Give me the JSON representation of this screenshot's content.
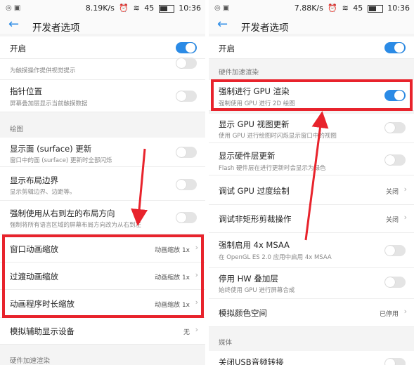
{
  "left": {
    "status": {
      "left_icons": "◎ ▣",
      "speed": "8.19K/s",
      "signal": "45",
      "time": "10:36"
    },
    "header": {
      "title": "开发者选项"
    },
    "rows": [
      {
        "label": "开启"
      },
      {
        "sub": "为触摸操作提供视觉提示"
      },
      {
        "label": "指针位置",
        "sub": "屏幕叠加层显示当前触摸数据"
      },
      {
        "section": "绘图"
      },
      {
        "label": "显示面 (surface) 更新",
        "sub": "窗口中的面 (surface) 更新时全部闪烁"
      },
      {
        "label": "显示布局边界",
        "sub": "显示剪辑边界、边距等。"
      },
      {
        "label": "强制使用从右到左的布局方向",
        "sub": "强制将所有语言区域的屏幕布局方向改为从右到左"
      },
      {
        "label": "窗口动画缩放",
        "value": "动画缩放 1x"
      },
      {
        "label": "过渡动画缩放",
        "value": "动画缩放 1x"
      },
      {
        "label": "动画程序时长缩放",
        "value": "动画缩放 1x"
      },
      {
        "label": "模拟辅助显示设备",
        "value": "无"
      },
      {
        "section": "硬件加速渲染"
      }
    ]
  },
  "right": {
    "status": {
      "left_icons": "◎ ▣",
      "speed": "7.88K/s",
      "signal": "45",
      "time": "10:36"
    },
    "header": {
      "title": "开发者选项"
    },
    "rows": [
      {
        "label": "开启"
      },
      {
        "section": "硬件加速渲染"
      },
      {
        "label": "强制进行 GPU 渲染",
        "sub": "强制使用 GPU 进行 2D 绘图"
      },
      {
        "label": "显示 GPU 视图更新",
        "sub": "使用 GPU 进行绘图时闪烁显示窗口中的视图"
      },
      {
        "label": "显示硬件层更新",
        "sub": "Flash 硬件层在进行更新时会显示为绿色"
      },
      {
        "label": "调试 GPU 过度绘制",
        "value": "关闭"
      },
      {
        "label": "调试非矩形剪裁操作",
        "value": "关闭"
      },
      {
        "label": "强制启用 4x MSAA",
        "sub": "在 OpenGL ES 2.0 应用中启用 4x MSAA"
      },
      {
        "label": "停用 HW 叠加层",
        "sub": "始终使用 GPU 进行屏幕合成"
      },
      {
        "label": "模拟颜色空间",
        "value": "已停用"
      },
      {
        "section": "媒体"
      },
      {
        "label": "关闭USB音频转接"
      }
    ]
  },
  "colors": {
    "accent": "#2b8be6",
    "highlight": "#e8232c"
  }
}
